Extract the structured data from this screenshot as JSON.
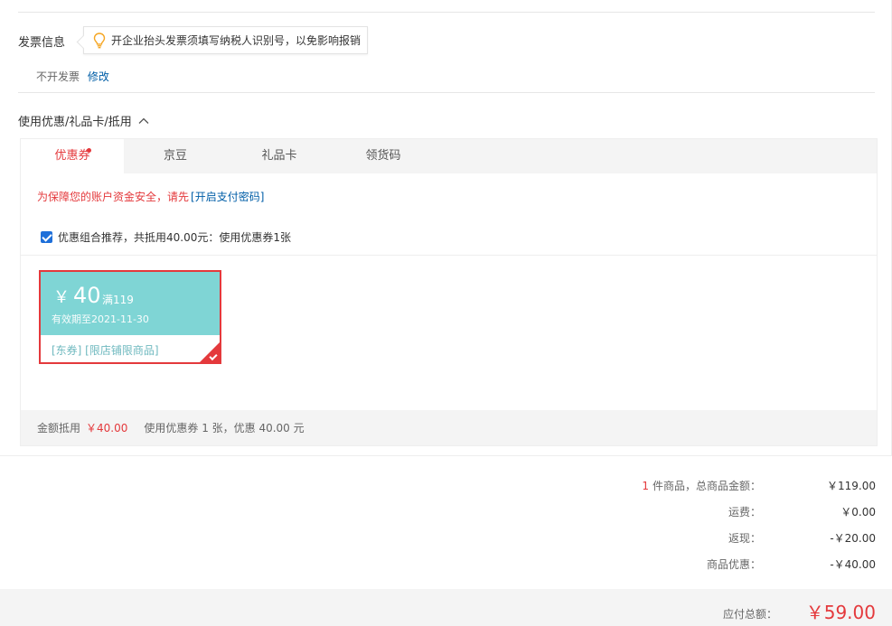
{
  "invoice": {
    "title": "发票信息",
    "tip": "开企业抬头发票须填写纳税人识别号，以免影响报销",
    "status": "不开发票",
    "edit": "修改"
  },
  "promotions": {
    "title": "使用优惠/礼品卡/抵用",
    "tabs": [
      {
        "label": "优惠券"
      },
      {
        "label": "京豆"
      },
      {
        "label": "礼品卡"
      },
      {
        "label": "领货码"
      }
    ],
    "security_text": "为保障您的账户资金安全，请先",
    "security_link": "[开启支付密码]",
    "combo_text": "优惠组合推荐，共抵用40.00元：使用优惠券1张",
    "coupon": {
      "symbol": "￥",
      "amount": "40",
      "condition": "满119",
      "expiry": "有效期至2021-11-30",
      "tags": "[东券]  [限店铺限商品]"
    },
    "footer": {
      "label": "金额抵用",
      "amount": "￥40.00",
      "desc": "使用优惠券 1 张，优惠 40.00 元"
    }
  },
  "summary": {
    "count": "1",
    "rows": [
      {
        "label": "件商品，总商品金额：",
        "value": "￥119.00"
      },
      {
        "label": "运费：",
        "value": "￥0.00"
      },
      {
        "label": "返现：",
        "value": "-￥20.00"
      },
      {
        "label": "商品优惠：",
        "value": "-￥40.00"
      }
    ],
    "total_label": "应付总额：",
    "total_value": "￥59.00"
  },
  "colors": {
    "accent": "#e4393c",
    "link": "#005ea7",
    "coupon_bg": "#7fd5d5"
  }
}
